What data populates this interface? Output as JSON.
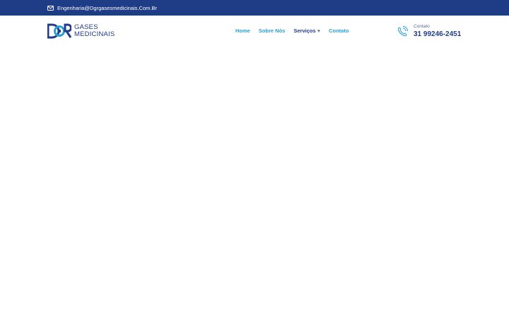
{
  "topbar": {
    "email": "Engenharia@Dgrgasesmedicinais.Com.Br",
    "email_icon": "envelope-icon",
    "background": "#1f3c86"
  },
  "logo": {
    "line1": "GASES",
    "line2": "MEDICINAIS",
    "mark_text": "DGR",
    "color_primary": "#1f3c86",
    "color_accent": "#2a9fd6"
  },
  "nav": {
    "items": [
      {
        "label": "Home"
      },
      {
        "label": "Sobre Nós"
      },
      {
        "label": "Serviços +"
      },
      {
        "label": "Contato"
      }
    ],
    "color_link": "#2a9fd6",
    "color_active": "#1f3c86"
  },
  "contact": {
    "icon": "phone-call-icon",
    "label": "Contato",
    "phone": "31 99246-2451"
  }
}
